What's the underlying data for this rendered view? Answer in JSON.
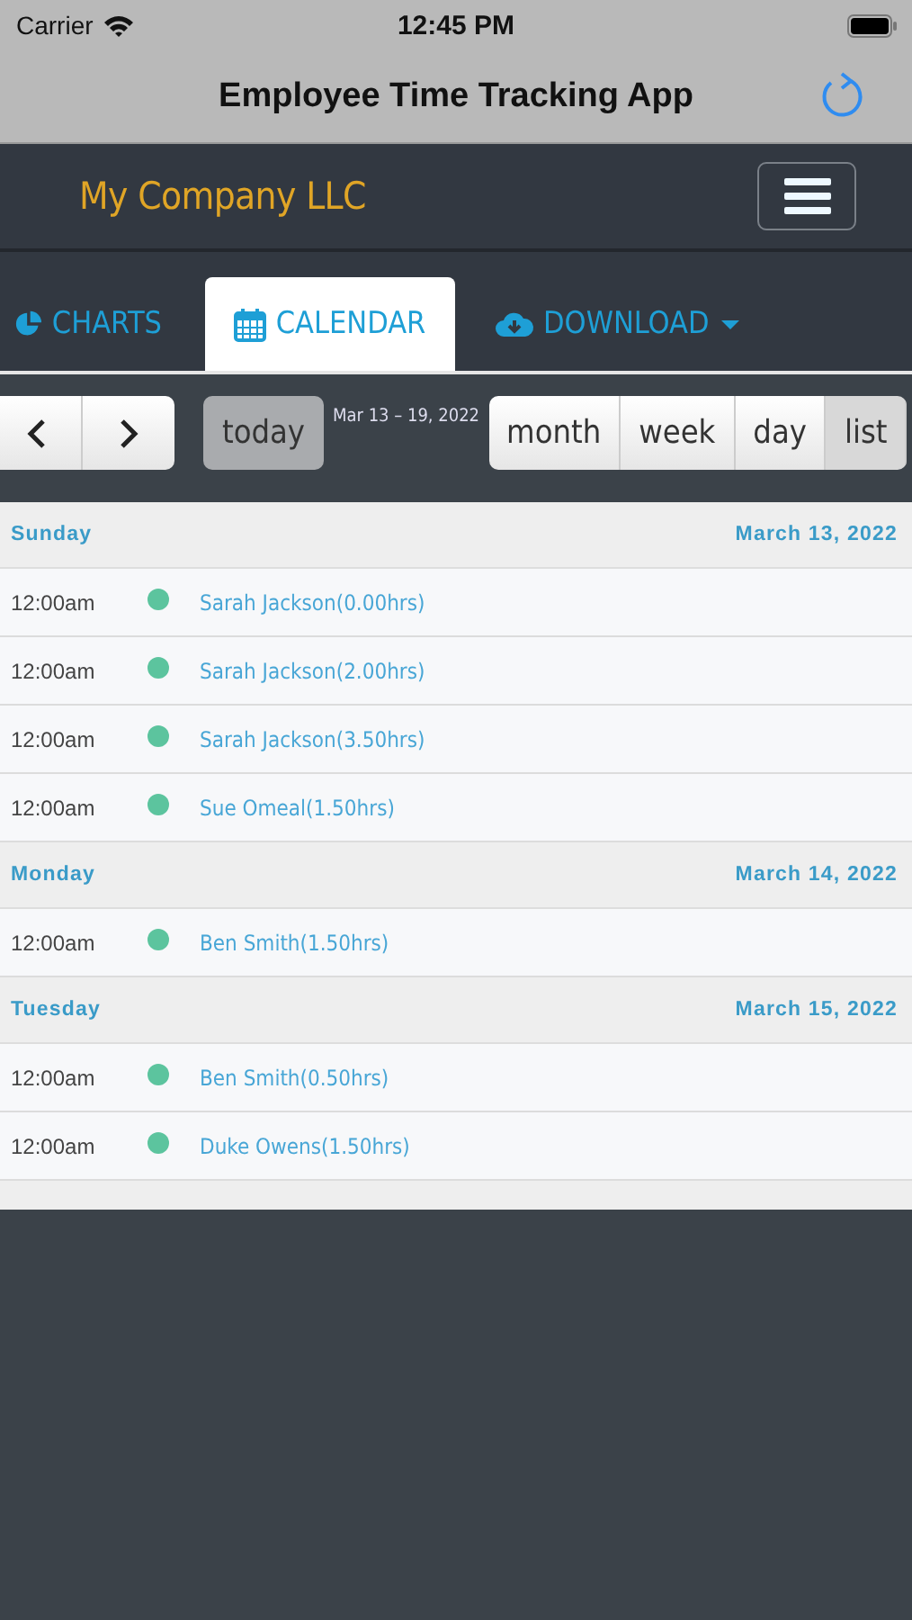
{
  "status_bar": {
    "carrier": "Carrier",
    "time": "12:45 PM"
  },
  "nav_bar": {
    "title": "Employee Time Tracking App"
  },
  "header": {
    "company": "My Company LLC"
  },
  "tabs": [
    {
      "label": "CHARTS",
      "kind": "tab",
      "selected": false
    },
    {
      "label": "CALENDAR",
      "kind": "tab",
      "selected": true
    },
    {
      "label": "DOWNLOAD",
      "kind": "dropdown",
      "selected": false
    }
  ],
  "toolbar": {
    "today": {
      "label": "today",
      "disabled": true
    },
    "range": "Mar 13 – 19, 2022",
    "views": [
      {
        "label": "month",
        "selected": false
      },
      {
        "label": "week",
        "selected": false
      },
      {
        "label": "day",
        "selected": false
      },
      {
        "label": "list",
        "selected": true
      }
    ]
  },
  "days": [
    {
      "day": "Sunday",
      "date": "March 13, 2022",
      "events": [
        {
          "time": "12:00am",
          "title": "Sarah Jackson(0.00hrs)"
        },
        {
          "time": "12:00am",
          "title": "Sarah Jackson(2.00hrs)"
        },
        {
          "time": "12:00am",
          "title": "Sarah Jackson(3.50hrs)"
        },
        {
          "time": "12:00am",
          "title": "Sue Omeal(1.50hrs)"
        }
      ]
    },
    {
      "day": "Monday",
      "date": "March 14, 2022",
      "events": [
        {
          "time": "12:00am",
          "title": "Ben Smith(1.50hrs)"
        }
      ]
    },
    {
      "day": "Tuesday",
      "date": "March 15, 2022",
      "events": [
        {
          "time": "12:00am",
          "title": "Ben Smith(0.50hrs)"
        },
        {
          "time": "12:00am",
          "title": "Duke Owens(1.50hrs)"
        }
      ]
    }
  ]
}
